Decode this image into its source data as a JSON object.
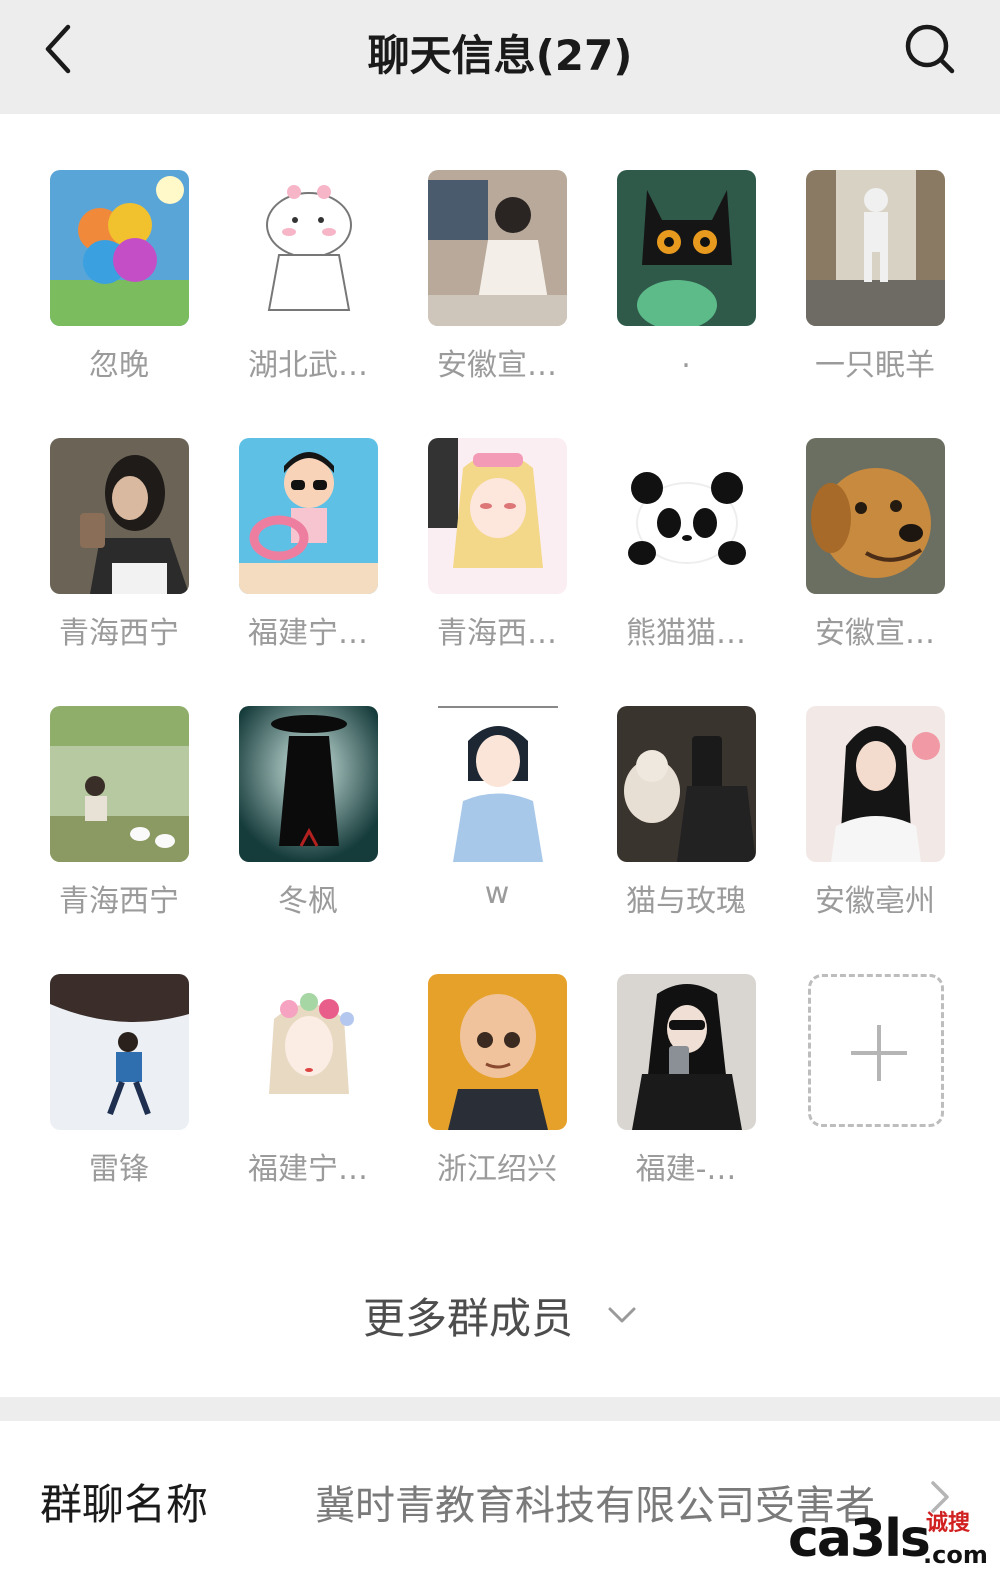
{
  "header": {
    "title": "聊天信息(27)",
    "back_icon": "chevron-left-icon",
    "search_icon": "search-icon"
  },
  "members": [
    {
      "name": "忽晚",
      "avatar": "rainbow-clover"
    },
    {
      "name": "湖北武…",
      "avatar": "cartoon-bear"
    },
    {
      "name": "安徽宣…",
      "avatar": "girl-sitting"
    },
    {
      "name": ".",
      "avatar": "black-cat"
    },
    {
      "name": "一只眠羊",
      "avatar": "astronaut-hallway"
    },
    {
      "name": "青海西宁",
      "avatar": "girl-drinking"
    },
    {
      "name": "福建宁…",
      "avatar": "cartoon-kid-sunglasses"
    },
    {
      "name": "青海西…",
      "avatar": "anime-girl"
    },
    {
      "name": "熊猫猫…",
      "avatar": "panda"
    },
    {
      "name": "安徽宣…",
      "avatar": "golden-dog"
    },
    {
      "name": "青海西宁",
      "avatar": "lake-geese"
    },
    {
      "name": "冬枫",
      "avatar": "silhouette-hat"
    },
    {
      "name": "w",
      "avatar": "anime-shorthair-girl"
    },
    {
      "name": "猫与玫瑰",
      "avatar": "cat-and-person"
    },
    {
      "name": "安徽亳州",
      "avatar": "woman-portrait"
    },
    {
      "name": "雷锋",
      "avatar": "snow-hiker"
    },
    {
      "name": "福建宁…",
      "avatar": "flower-crown-girl"
    },
    {
      "name": "浙江绍兴",
      "avatar": "bald-kid"
    },
    {
      "name": "福建-…",
      "avatar": "mirror-selfie"
    }
  ],
  "add_member_icon": "plus-icon",
  "more_members": {
    "label": "更多群成员",
    "icon": "chevron-down-icon"
  },
  "group_name_row": {
    "label": "群聊名称",
    "value": "冀时青教育科技有限公司受害者",
    "icon": "chevron-right-icon"
  },
  "watermark": {
    "text": "ca3ls",
    "sub": "诚搜",
    "dotcom": ".com"
  },
  "colors": {
    "header_bg": "#ededed",
    "name_gray": "#9b9b9b"
  }
}
